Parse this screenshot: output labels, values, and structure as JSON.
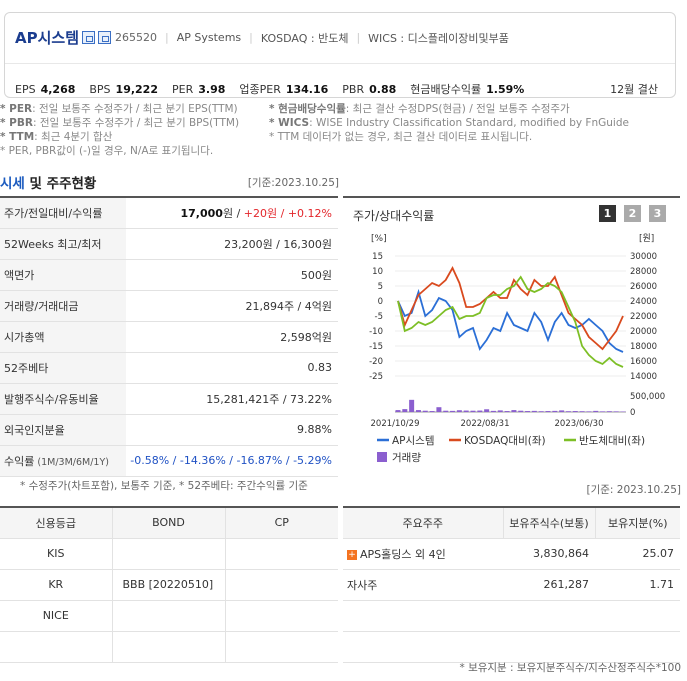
{
  "header": {
    "name": "AP시스템",
    "code": "265520",
    "eng_name": "AP Systems",
    "market": "KOSDAQ : 반도체",
    "wics": "WICS : 디스플레이장비및부품",
    "metrics": [
      {
        "label": "EPS",
        "value": "4,268"
      },
      {
        "label": "BPS",
        "value": "19,222"
      },
      {
        "label": "PER",
        "value": "3.98"
      },
      {
        "label": "업종PER",
        "value": "134.16"
      },
      {
        "label": "PBR",
        "value": "0.88"
      },
      {
        "label": "현금배당수익률",
        "value": "1.59%"
      }
    ],
    "settlement": "12월 결산"
  },
  "notes_left": [
    {
      "key": "* PER",
      "text": ": 전일 보통주 수정주가 / 최근 분기 EPS(TTM)"
    },
    {
      "key": "* PBR",
      "text": ": 전일 보통주 수정주가 / 최근 분기 BPS(TTM)"
    },
    {
      "key": "* TTM",
      "text": ": 최근 4분기 합산"
    },
    {
      "key": "",
      "text": "* PER, PBR값이 (-)일 경우, N/A로 표기됩니다."
    }
  ],
  "notes_right": [
    {
      "key": "* 현금배당수익률",
      "text": ": 최근 결산 수정DPS(현금) / 전일 보통주 수정주가"
    },
    {
      "key": "* WICS",
      "text": ": WISE Industry Classification Standard, modified by FnGuide"
    },
    {
      "key": "",
      "text": "* TTM 데이터가 없는 경우, 최근 결산 데이터로 표시됩니다."
    }
  ],
  "section": {
    "title_blue": "시세",
    "title_rest": " 및 주주현황",
    "base_date": "[기준:2023.10.25]"
  },
  "quote_table": {
    "rows": [
      {
        "label": "주가/전일대비/수익률",
        "parts": [
          {
            "t": "17,000",
            "c": "bold"
          },
          {
            "t": "원 / ",
            "c": ""
          },
          {
            "t": "+20",
            "c": "red"
          },
          {
            "t": "원 / ",
            "c": "red"
          },
          {
            "t": "+0.12%",
            "c": "red"
          }
        ]
      },
      {
        "label": "52Weeks 최고/최저",
        "parts": [
          {
            "t": "23,200원 / 16,300원",
            "c": ""
          }
        ]
      },
      {
        "label": "액면가",
        "parts": [
          {
            "t": "500원",
            "c": ""
          }
        ]
      },
      {
        "label": "거래량/거래대금",
        "parts": [
          {
            "t": "21,894주 / 4억원",
            "c": ""
          }
        ]
      },
      {
        "label": "시가총액",
        "parts": [
          {
            "t": "2,598억원",
            "c": ""
          }
        ]
      },
      {
        "label": "52주베타",
        "parts": [
          {
            "t": "0.83",
            "c": ""
          }
        ]
      },
      {
        "label": "발행주식수/유동비율",
        "parts": [
          {
            "t": "15,281,421주 / 73.22%",
            "c": ""
          }
        ]
      },
      {
        "label": "외국인지분율",
        "parts": [
          {
            "t": "9.88%",
            "c": ""
          }
        ]
      },
      {
        "label": "수익률",
        "label_small": "(1M/3M/6M/1Y)",
        "parts": [
          {
            "t": "-0.58% / -14.36% / -16.87% / -5.29%",
            "c": "blu"
          }
        ]
      }
    ],
    "footnote": "* 수정주가(차트포함), 보통주 기준, * 52주베타: 주간수익률 기준"
  },
  "chart_panel": {
    "title": "주가/상대수익률",
    "buttons": [
      "1",
      "2",
      "3"
    ],
    "left_unit": "[%]",
    "right_unit": "[원]"
  },
  "chart_data": {
    "type": "line",
    "x_ticks": [
      "2021/10/29",
      "2022/08/31",
      "2023/06/30"
    ],
    "left_axis": {
      "ticks": [
        "15",
        "10",
        "5",
        "0",
        "-5",
        "-10",
        "-15",
        "-20",
        "-25"
      ],
      "ylim": [
        -25,
        15
      ]
    },
    "right_axis": {
      "ticks": [
        "30000",
        "28000",
        "26000",
        "24000",
        "22000",
        "20000",
        "18000",
        "16000",
        "14000"
      ],
      "ylim": [
        14000,
        30000
      ]
    },
    "volume_axis": {
      "ticks": [
        "500,000",
        "0"
      ],
      "ylim": [
        0,
        500000
      ]
    },
    "series": [
      {
        "name": "AP시스템",
        "color": "#2b6fd6",
        "values": [
          0,
          -5,
          -4,
          3,
          -5,
          -3,
          1,
          0,
          -3,
          -12,
          -10,
          -9,
          -16,
          -13,
          -9,
          -10,
          -4,
          -8,
          -9,
          -10,
          -4,
          -7,
          -13,
          -7,
          -4,
          -8,
          -9,
          -8,
          -6,
          -8,
          -10,
          -14,
          -16,
          -17
        ]
      },
      {
        "name": "KOSDAQ대비(좌)",
        "color": "#d94a1e",
        "values": [
          0,
          -8,
          -3,
          2,
          4,
          6,
          5,
          7,
          11,
          6,
          -2,
          -2,
          -1,
          1,
          3,
          1,
          1,
          7,
          4,
          2,
          7,
          5,
          5,
          8,
          2,
          -4,
          -6,
          -8,
          -12,
          -14,
          -16,
          -13,
          -10,
          -5
        ]
      },
      {
        "name": "반도체대비(좌)",
        "color": "#7dbf26",
        "values": [
          0,
          -10,
          -9,
          -7,
          -8,
          -7,
          -5,
          -3,
          -2,
          -6,
          -5,
          -5,
          -4,
          1,
          2,
          2,
          4,
          5,
          8,
          4,
          3,
          4,
          6,
          5,
          3,
          -2,
          -7,
          -15,
          -18,
          -20,
          -21,
          -19,
          -21,
          -22
        ]
      }
    ],
    "volume": {
      "name": "거래량",
      "color": "#8b5fcf",
      "values": [
        60000,
        90000,
        380000,
        60000,
        40000,
        30000,
        150000,
        40000,
        35000,
        55000,
        45000,
        40000,
        45000,
        85000,
        35000,
        50000,
        30000,
        60000,
        40000,
        30000,
        35000,
        25000,
        30000,
        35000,
        50000,
        25000,
        30000,
        25000,
        20000,
        35000,
        20000,
        25000,
        20000,
        15000
      ]
    }
  },
  "credit_table": {
    "headers": [
      "신용등급",
      "BOND",
      "CP"
    ],
    "rows": [
      {
        "agency": "KIS",
        "bond": "",
        "cp": ""
      },
      {
        "agency": "KR",
        "bond": "BBB   [20220510]",
        "cp": ""
      },
      {
        "agency": "NICE",
        "bond": "",
        "cp": ""
      },
      {
        "agency": "",
        "bond": "",
        "cp": ""
      }
    ]
  },
  "shareholders": {
    "base_date": "[기준: 2023.10.25]",
    "headers": [
      "주요주주",
      "보유주식수(보통)",
      "보유지분(%)"
    ],
    "rows": [
      {
        "name": "APS홀딩스 외 4인",
        "shares": "3,830,864",
        "ratio": "25.07",
        "expand": "+"
      },
      {
        "name": "자사주",
        "shares": "261,287",
        "ratio": "1.71",
        "expand": ""
      },
      {
        "name": "",
        "shares": "",
        "ratio": "",
        "expand": ""
      },
      {
        "name": "",
        "shares": "",
        "ratio": "",
        "expand": ""
      }
    ],
    "footnote": "* 보유지분 : 보유지분주식수/지수산정주식수*100"
  }
}
